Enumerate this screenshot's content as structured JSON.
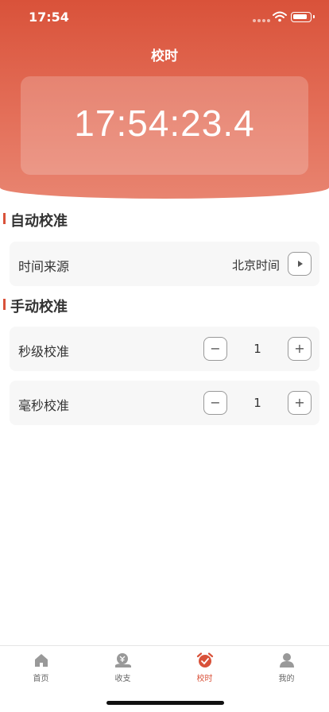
{
  "status_bar": {
    "time": "17:54"
  },
  "page": {
    "title": "校时"
  },
  "clock": {
    "time": "17:54:23.4"
  },
  "auto_section": {
    "title": "自动校准",
    "rows": [
      {
        "label": "时间来源",
        "value": "北京时间"
      }
    ]
  },
  "manual_section": {
    "title": "手动校准",
    "rows": [
      {
        "label": "秒级校准",
        "value": "1",
        "minus": "−",
        "plus": "+"
      },
      {
        "label": "毫秒校准",
        "value": "1",
        "minus": "−",
        "plus": "+"
      }
    ]
  },
  "tabbar": {
    "items": [
      {
        "label": "首页",
        "icon": "home-icon"
      },
      {
        "label": "收支",
        "icon": "money-icon"
      },
      {
        "label": "校时",
        "icon": "alarm-clock-icon",
        "active": true
      },
      {
        "label": "我的",
        "icon": "user-icon"
      }
    ]
  },
  "colors": {
    "accent": "#d9523a",
    "card_bg": "#f7f7f7",
    "tab_inactive": "#999999"
  }
}
